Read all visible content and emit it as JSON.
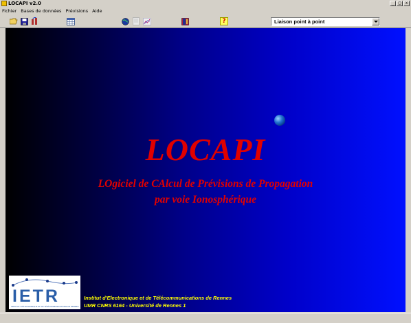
{
  "window": {
    "title": "LOCAPI v2.0",
    "buttons": {
      "minimize": "_",
      "maximize": "□",
      "close": "x"
    }
  },
  "menu": {
    "items": [
      {
        "label": "Fichier"
      },
      {
        "label": "Bases de données"
      },
      {
        "label": "Prévisions"
      },
      {
        "label": "Aide"
      }
    ]
  },
  "toolbar": {
    "buttons": [
      {
        "icon": "folder-open-icon"
      },
      {
        "icon": "save-icon"
      },
      {
        "icon": "antenna-icon"
      },
      {
        "icon": "table-icon"
      },
      {
        "icon": "globe-run-icon"
      },
      {
        "icon": "document-icon"
      },
      {
        "icon": "chart-icon"
      },
      {
        "icon": "book-icon"
      },
      {
        "icon": "help-icon",
        "text": "?"
      }
    ],
    "mode_select": {
      "value": "Liaison point à point"
    }
  },
  "splash": {
    "title": "LOCAPI",
    "subtitle_line1": "LOgiciel de CAlcul de Prévisions de Propagation",
    "subtitle_line2": "par voie Ionosphérique",
    "logo_text": "IETR",
    "logo_caption": "INSTITUT D'ÉLECTRONIQUE ET DE TÉLÉCOMMUNICATIONS DE RENNES",
    "institute_line1": "Institut d'Electronique et de Télécommunications de Rennes",
    "institute_line2": "UMR CNRS 6164 - Université de Rennes 1",
    "colors": {
      "title": "#e00000",
      "institute": "#ffff00",
      "gradient_start": "#000000",
      "gradient_end": "#0010ff"
    }
  }
}
